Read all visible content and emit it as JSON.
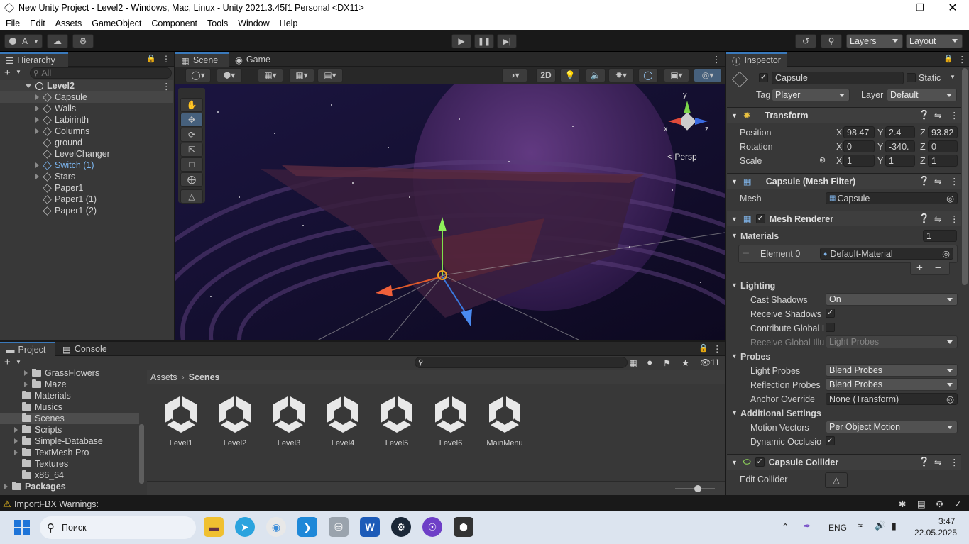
{
  "window": {
    "title": "New Unity Project - Level2 - Windows, Mac, Linux - Unity 2021.3.45f1 Personal <DX11>"
  },
  "menu": [
    "File",
    "Edit",
    "Assets",
    "GameObject",
    "Component",
    "Tools",
    "Window",
    "Help"
  ],
  "toolbar": {
    "account": "A",
    "layers": "Layers",
    "layout": "Layout"
  },
  "hierarchy": {
    "tab": "Hierarchy",
    "search_placeholder": "All",
    "scene": "Level2",
    "items": [
      {
        "label": "Capsule",
        "expandable": true,
        "selected": true
      },
      {
        "label": "Walls",
        "expandable": true
      },
      {
        "label": "Labirinth",
        "expandable": true
      },
      {
        "label": "Columns",
        "expandable": true
      },
      {
        "label": "ground",
        "expandable": false
      },
      {
        "label": "LevelChanger",
        "expandable": false
      },
      {
        "label": "Switch (1)",
        "expandable": true,
        "prefab": true
      },
      {
        "label": "Stars",
        "expandable": true
      },
      {
        "label": "Paper1",
        "expandable": false
      },
      {
        "label": "Paper1 (1)",
        "expandable": false
      },
      {
        "label": "Paper1 (2)",
        "expandable": false
      }
    ]
  },
  "scene_view": {
    "tabs": [
      "Scene",
      "Game"
    ],
    "btn_2d": "2D",
    "persp": "< Persp",
    "gizmo_y": "y",
    "gizmo_x": "x",
    "gizmo_z": "z"
  },
  "project": {
    "tabs": [
      "Project",
      "Console"
    ],
    "breadcrumb": [
      "Assets",
      "Scenes"
    ],
    "hidden_count": "11",
    "folders": [
      {
        "label": "GrassFlowers",
        "indent": 2,
        "expandable": true
      },
      {
        "label": "Maze",
        "indent": 2,
        "expandable": true
      },
      {
        "label": "Materials",
        "indent": 1,
        "expandable": false
      },
      {
        "label": "Musics",
        "indent": 1,
        "expandable": false
      },
      {
        "label": "Scenes",
        "indent": 1,
        "expandable": false,
        "selected": true
      },
      {
        "label": "Scripts",
        "indent": 1,
        "expandable": true
      },
      {
        "label": "Simple-Database",
        "indent": 1,
        "expandable": true
      },
      {
        "label": "TextMesh Pro",
        "indent": 1,
        "expandable": true
      },
      {
        "label": "Textures",
        "indent": 1,
        "expandable": false
      },
      {
        "label": "x86_64",
        "indent": 1,
        "expandable": false
      },
      {
        "label": "Packages",
        "indent": 0,
        "expandable": true
      }
    ],
    "assets": [
      "Level1",
      "Level2",
      "Level3",
      "Level4",
      "Level5",
      "Level6",
      "MainMenu"
    ]
  },
  "inspector": {
    "tab": "Inspector",
    "object_name": "Capsule",
    "static_label": "Static",
    "tag_label": "Tag",
    "tag_value": "Player",
    "layer_label": "Layer",
    "layer_value": "Default",
    "transform": {
      "title": "Transform",
      "position_label": "Position",
      "position": {
        "x": "98.47",
        "y": "2.4",
        "z": "93.82"
      },
      "rotation_label": "Rotation",
      "rotation": {
        "x": "0",
        "y": "-340.",
        "z": "0"
      },
      "scale_label": "Scale",
      "scale": {
        "x": "1",
        "y": "1",
        "z": "1"
      }
    },
    "mesh_filter": {
      "title": "Capsule (Mesh Filter)",
      "mesh_label": "Mesh",
      "mesh_value": "Capsule"
    },
    "mesh_renderer": {
      "title": "Mesh Renderer",
      "materials_label": "Materials",
      "materials_count": "1",
      "element_label": "Element 0",
      "element_value": "Default-Material",
      "lighting_label": "Lighting",
      "cast_shadows_label": "Cast Shadows",
      "cast_shadows_value": "On",
      "receive_shadows_label": "Receive Shadows",
      "contribute_gi_label": "Contribute Global I",
      "receive_gi_label": "Receive Global Illu",
      "receive_gi_value": "Light Probes",
      "probes_label": "Probes",
      "light_probes_label": "Light Probes",
      "light_probes_value": "Blend Probes",
      "reflection_probes_label": "Reflection Probes",
      "reflection_probes_value": "Blend Probes",
      "anchor_override_label": "Anchor Override",
      "anchor_override_value": "None (Transform)",
      "additional_label": "Additional Settings",
      "motion_vectors_label": "Motion Vectors",
      "motion_vectors_value": "Per Object Motion",
      "dynamic_occlusion_label": "Dynamic Occlusio"
    },
    "capsule_collider": {
      "title": "Capsule Collider",
      "edit_collider_label": "Edit Collider"
    }
  },
  "status_bar": {
    "warning": "ImportFBX Warnings:"
  },
  "taskbar": {
    "search_placeholder": "Поиск",
    "lang": "ENG",
    "time": "3:47",
    "date": "22.05.2025"
  },
  "colors": {
    "accent": "#3a79bb",
    "selection": "#2c5d87",
    "bg_panel": "#383838",
    "bg_dark": "#191919"
  }
}
